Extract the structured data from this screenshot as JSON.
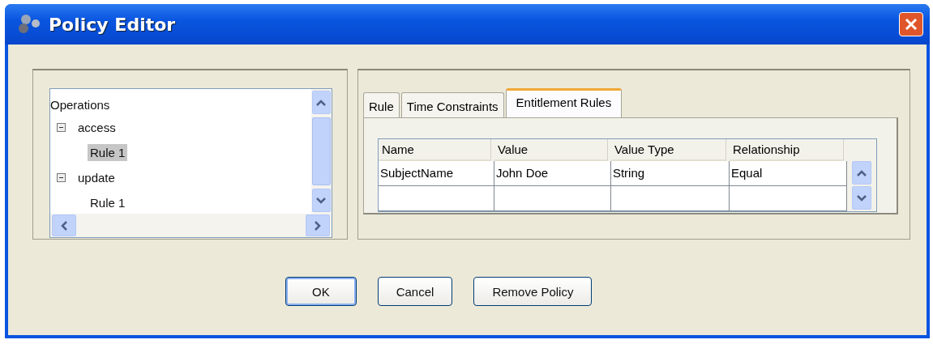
{
  "window": {
    "title": "Policy Editor"
  },
  "tree": {
    "root": "Operations",
    "items": [
      {
        "label": "access",
        "expanded": true,
        "selected": false,
        "children": [
          {
            "label": "Rule 1",
            "selected": true
          }
        ]
      },
      {
        "label": "update",
        "expanded": true,
        "selected": false,
        "children": [
          {
            "label": "Rule 1",
            "selected": false
          }
        ]
      }
    ]
  },
  "tabs": [
    {
      "label": "Rule",
      "selected": false
    },
    {
      "label": "Time Constraints",
      "selected": false
    },
    {
      "label": "Entitlement Rules",
      "selected": true
    }
  ],
  "table": {
    "columns": [
      "Name",
      "Value",
      "Value Type",
      "Relationship"
    ],
    "rows": [
      [
        "SubjectName",
        "John Doe",
        "String",
        "Equal"
      ],
      [
        "",
        "",
        "",
        ""
      ]
    ]
  },
  "buttons": [
    {
      "label": "OK",
      "default": true
    },
    {
      "label": "Cancel",
      "default": false
    },
    {
      "label": "Remove Policy",
      "default": false
    }
  ]
}
